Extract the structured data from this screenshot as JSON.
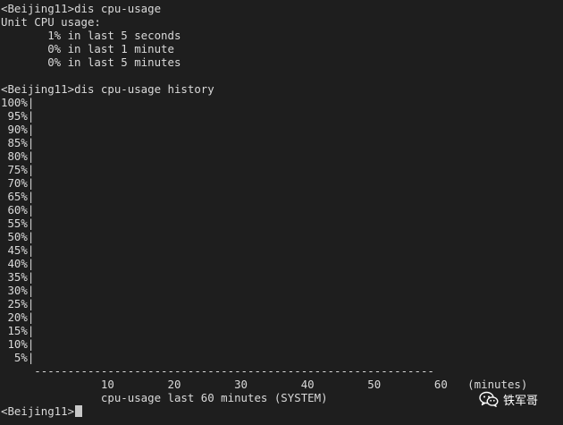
{
  "terminal": {
    "cmd1": {
      "prompt": "<Beijing11>",
      "command": "dis cpu-usage"
    },
    "unit_title": "Unit CPU usage:",
    "usage_lines": [
      "       1% in last 5 seconds",
      "       0% in last 1 minute",
      "       0% in last 5 minutes"
    ],
    "cmd2": {
      "prompt": "<Beijing11>",
      "command": "dis cpu-usage history"
    },
    "y_axis_labels": [
      "100%|",
      " 95%|",
      " 90%|",
      " 85%|",
      " 80%|",
      " 75%|",
      " 70%|",
      " 65%|",
      " 60%|",
      " 55%|",
      " 50%|",
      " 45%|",
      " 40%|",
      " 35%|",
      " 30%|",
      " 25%|",
      " 20%|",
      " 15%|",
      " 10%|",
      "  5%|"
    ],
    "x_axis_line": "     ------------------------------------------------------------",
    "x_axis_ticks": "               10        20        30        40        50        60   (minutes)",
    "chart_caption": "               cpu-usage last 60 minutes (SYSTEM)",
    "final_prompt": "<Beijing11>"
  },
  "watermark": {
    "text": "铁军哥",
    "icon": "wechat-icon"
  }
}
